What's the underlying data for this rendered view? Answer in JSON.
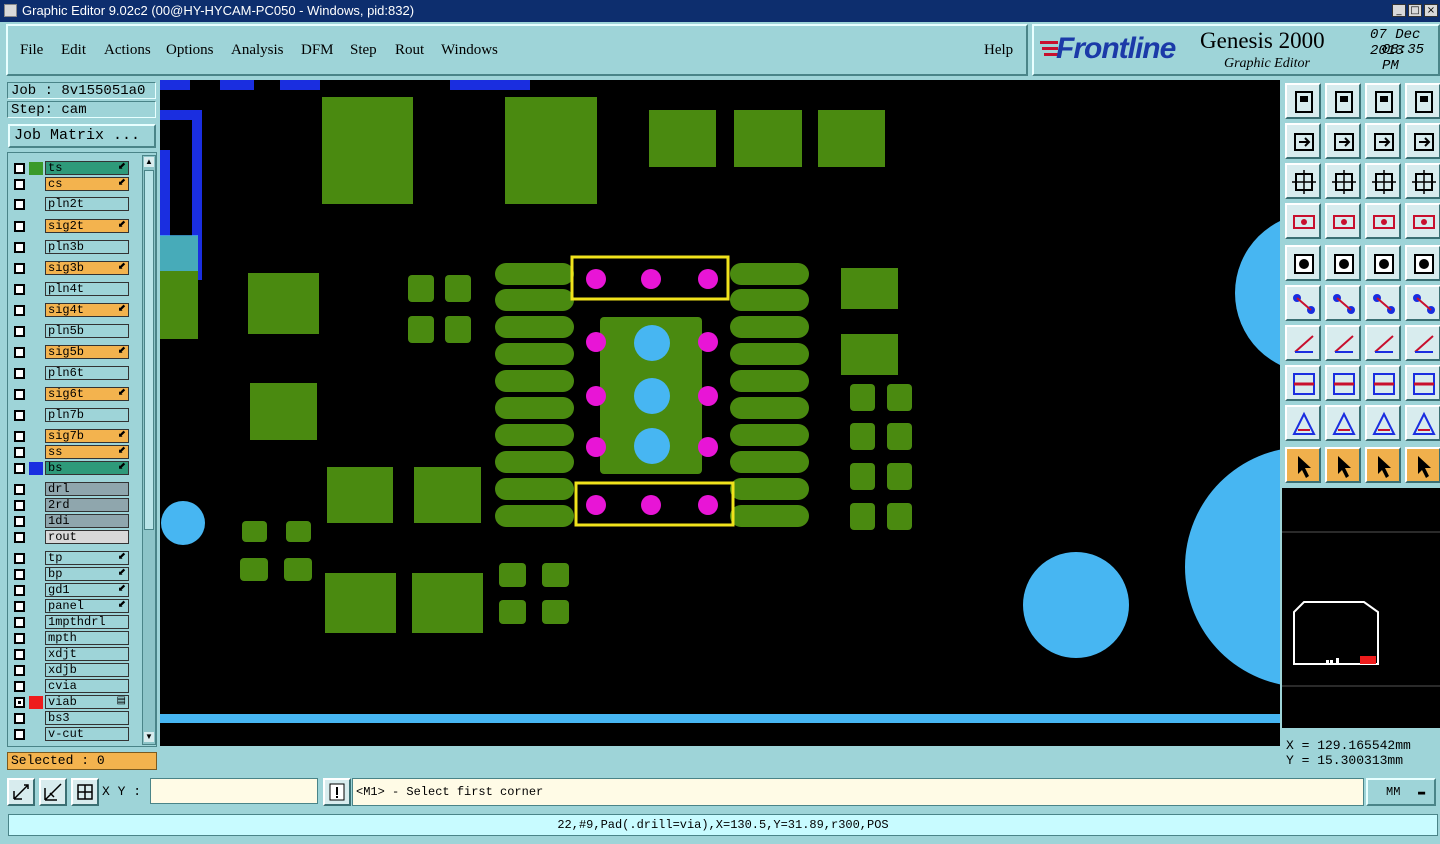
{
  "window": {
    "title": "Graphic Editor 9.02c2 (00@HY-HYCAM-PC050 - Windows, pid:832)"
  },
  "menu": {
    "file": "File",
    "edit": "Edit",
    "actions": "Actions",
    "options": "Options",
    "analysis": "Analysis",
    "dfm": "DFM",
    "step": "Step",
    "rout": "Rout",
    "windows": "Windows",
    "help": "Help"
  },
  "brand": {
    "logo": "Frontline",
    "product": "Genesis 2000",
    "subtitle": "Graphic Editor",
    "date": "07 Dec 2013",
    "time": "08:35 PM"
  },
  "job": {
    "job_label": "Job : 8v155051a0",
    "step_label": "Step: cam",
    "matrix_button": "Job Matrix ..."
  },
  "layers": [
    {
      "name": "ts",
      "color": "#2e9a7a",
      "swatch": "#3a9a2a",
      "mark": "⬋"
    },
    {
      "name": "cs",
      "color": "#f3b34e",
      "swatch": "",
      "mark": "⬋"
    },
    {
      "name": "pln2t",
      "color": "#9ed4d8",
      "swatch": "",
      "mark": ""
    },
    {
      "name": "sig2t",
      "color": "#f3b34e",
      "swatch": "",
      "mark": "⬋"
    },
    {
      "name": "pln3b",
      "color": "#9ed4d8",
      "swatch": "",
      "mark": ""
    },
    {
      "name": "sig3b",
      "color": "#f3b34e",
      "swatch": "",
      "mark": "⬋"
    },
    {
      "name": "pln4t",
      "color": "#9ed4d8",
      "swatch": "",
      "mark": ""
    },
    {
      "name": "sig4t",
      "color": "#f3b34e",
      "swatch": "",
      "mark": "⬋"
    },
    {
      "name": "pln5b",
      "color": "#9ed4d8",
      "swatch": "",
      "mark": ""
    },
    {
      "name": "sig5b",
      "color": "#f3b34e",
      "swatch": "",
      "mark": "⬋"
    },
    {
      "name": "pln6t",
      "color": "#9ed4d8",
      "swatch": "",
      "mark": ""
    },
    {
      "name": "sig6t",
      "color": "#f3b34e",
      "swatch": "",
      "mark": "⬋"
    },
    {
      "name": "pln7b",
      "color": "#9ed4d8",
      "swatch": "",
      "mark": ""
    },
    {
      "name": "sig7b",
      "color": "#f3b34e",
      "swatch": "",
      "mark": "⬋"
    },
    {
      "name": "ss",
      "color": "#f3b34e",
      "swatch": "",
      "mark": "⬋"
    },
    {
      "name": "bs",
      "color": "#2e9a7a",
      "swatch": "#1a2ee0",
      "mark": "⬋"
    },
    {
      "name": "drl",
      "color": "#8fa6ad",
      "swatch": "",
      "mark": ""
    },
    {
      "name": "2rd",
      "color": "#8fa6ad",
      "swatch": "",
      "mark": ""
    },
    {
      "name": "1di",
      "color": "#8fa6ad",
      "swatch": "",
      "mark": ""
    },
    {
      "name": "rout",
      "color": "#d9d9d9",
      "swatch": "",
      "mark": ""
    },
    {
      "name": "tp",
      "color": "#9ed4d8",
      "swatch": "",
      "mark": "⬋"
    },
    {
      "name": "bp",
      "color": "#9ed4d8",
      "swatch": "",
      "mark": "⬋"
    },
    {
      "name": "gd1",
      "color": "#9ed4d8",
      "swatch": "",
      "mark": "⬋"
    },
    {
      "name": "panel",
      "color": "#9ed4d8",
      "swatch": "",
      "mark": "⬋"
    },
    {
      "name": "1mpthdrl",
      "color": "#9ed4d8",
      "swatch": "",
      "mark": ""
    },
    {
      "name": "mpth",
      "color": "#9ed4d8",
      "swatch": "",
      "mark": ""
    },
    {
      "name": "xdjt",
      "color": "#9ed4d8",
      "swatch": "",
      "mark": ""
    },
    {
      "name": "xdjb",
      "color": "#9ed4d8",
      "swatch": "",
      "mark": ""
    },
    {
      "name": "cvia",
      "color": "#9ed4d8",
      "swatch": "",
      "mark": ""
    },
    {
      "name": "viab",
      "color": "#9ed4d8",
      "swatch": "#ee1c1c",
      "mark": "▤"
    },
    {
      "name": "bs3",
      "color": "#9ed4d8",
      "swatch": "",
      "mark": ""
    },
    {
      "name": "v-cut",
      "color": "#9ed4d8",
      "swatch": "",
      "mark": ""
    }
  ],
  "selected": "Selected : 0",
  "coords": {
    "x": "X = 129.165542mm",
    "y": "Y = 15.300313mm"
  },
  "cmd": {
    "xy_label": "X Y :",
    "xy_value": "",
    "prompt": "<M1> - Select first corner",
    "units": "MM"
  },
  "status": "22,#9,Pad(.drill=via),X=130.5,Y=31.89,r300,POS",
  "colors": {
    "copper": "#4a8a10",
    "pad_blue": "#47b6f2",
    "via_magenta": "#e815d6",
    "highlight": "#f0e21c",
    "trace_blue": "#1a2ee0"
  }
}
